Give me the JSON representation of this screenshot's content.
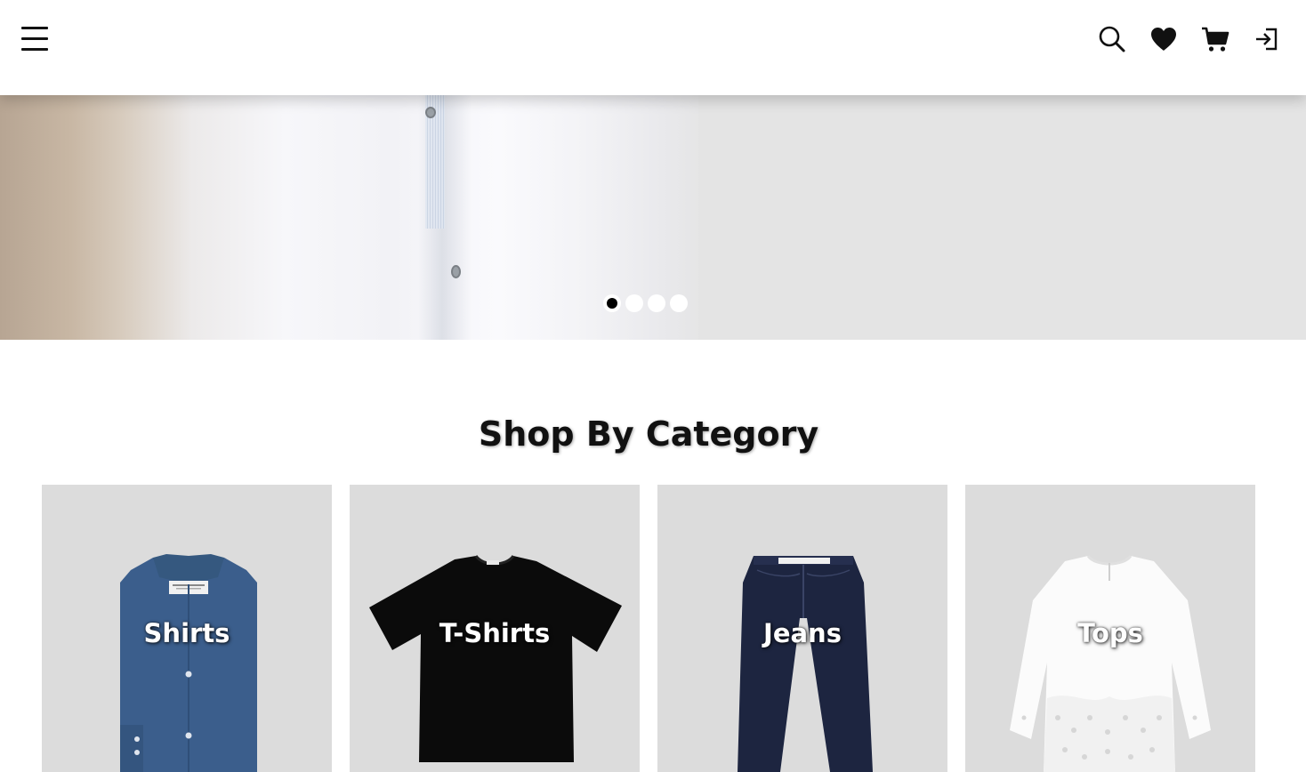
{
  "header": {
    "icons": [
      "menu-icon",
      "search-icon",
      "heart-icon",
      "cart-icon",
      "login-icon"
    ]
  },
  "hero": {
    "slides_count": 4,
    "active_slide": 1
  },
  "categories_section": {
    "title": "Shop By Category",
    "items": [
      {
        "label": "Shirts",
        "icon": "shirt-image"
      },
      {
        "label": "T-Shirts",
        "icon": "tshirt-image"
      },
      {
        "label": "Jeans",
        "icon": "jeans-image"
      },
      {
        "label": "Tops",
        "icon": "top-image"
      }
    ]
  },
  "colors": {
    "background": "#ffffff",
    "card_background": "#dcdcdc",
    "hero_background": "#e4e4e4",
    "text": "#111111"
  }
}
